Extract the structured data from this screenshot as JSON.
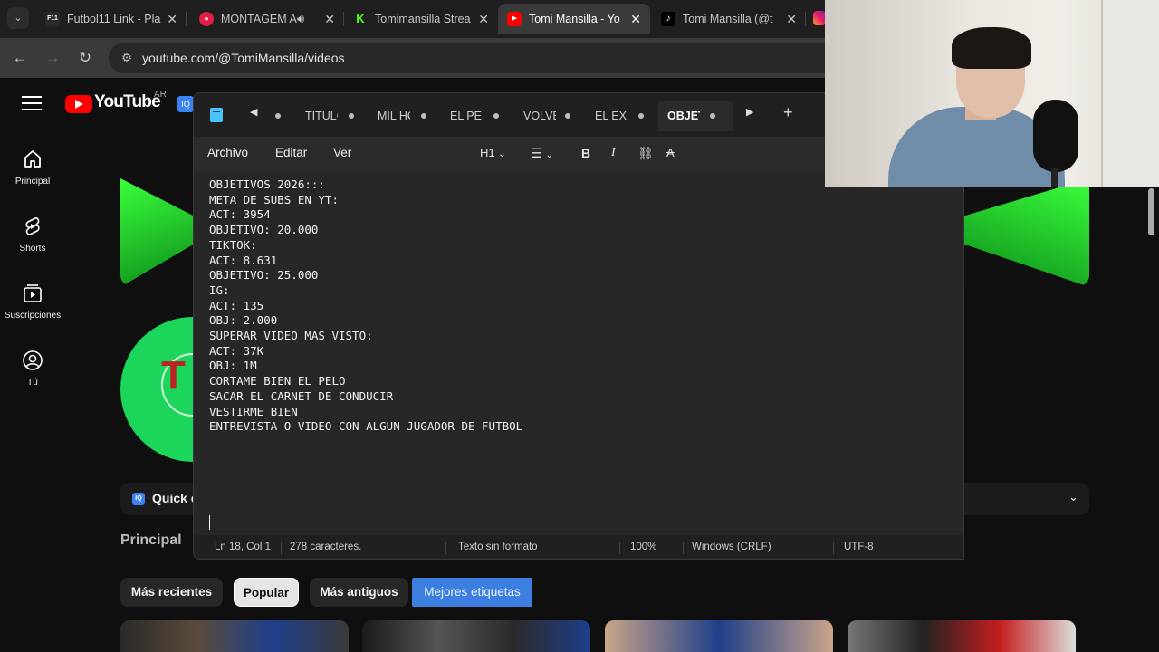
{
  "browser": {
    "tabs": [
      {
        "title": "Futbol11 Link - Pla",
        "icon": "F11",
        "icon_color": "#2a2a2a"
      },
      {
        "title": "MONTAGEM A",
        "icon": "●",
        "icon_color": "#e11d48",
        "has_audio": true
      },
      {
        "title": "Tomimansilla Strea",
        "icon": "K",
        "icon_color": "#53fc18"
      },
      {
        "title": "Tomi Mansilla - Yo",
        "icon": "▶",
        "icon_color": "#ff0000",
        "active": true
      },
      {
        "title": "Tomi Mansilla (@t",
        "icon": "♪",
        "icon_color": "#000000"
      }
    ],
    "close_glyph": "✕",
    "url": "youtube.com/@TomiMansilla/videos"
  },
  "youtube": {
    "logo_text": "YouTube",
    "country": "AR",
    "sidebar": [
      {
        "label": "Principal",
        "icon": "home-icon"
      },
      {
        "label": "Shorts",
        "icon": "shorts-icon"
      },
      {
        "label": "Suscripciones",
        "icon": "subscriptions-icon"
      },
      {
        "label": "Tú",
        "icon": "you-icon"
      }
    ],
    "quick_bar_text": "Quick c",
    "section_title": "Principal",
    "chips": [
      "Más recientes",
      "Popular",
      "Más antiguos",
      "Mejores etiquetas"
    ],
    "selected_chip": "Popular"
  },
  "notepad": {
    "tabs": [
      "TITULO",
      "MIL HO",
      "EL PER",
      "VOLVE",
      "EL EXT",
      "OBJET"
    ],
    "active_tab": "OBJET",
    "menu": [
      "Archivo",
      "Editar",
      "Ver"
    ],
    "format": {
      "heading": "H1"
    },
    "content": "OBJETIVOS 2026:::\nMETA DE SUBS EN YT:\nACT: 3954\nOBJETIVO: 20.000\nTIKTOK:\nACT: 8.631\nOBJETIVO: 25.000\nIG:\nACT: 135\nOBJ: 2.000\nSUPERAR VIDEO MAS VISTO:\nACT: 37K\nOBJ: 1M\nCORTAME BIEN EL PELO\nSACAR EL CARNET DE CONDUCIR\nVESTIRME BIEN\nENTREVISTA O VIDEO CON ALGUN JUGADOR DE FUTBOL",
    "status": {
      "position": "Ln 18, Col 1",
      "chars": "278 caracteres.",
      "format": "Texto sin formato",
      "zoom": "100%",
      "line_ending": "Windows (CRLF)",
      "encoding": "UTF-8"
    }
  }
}
